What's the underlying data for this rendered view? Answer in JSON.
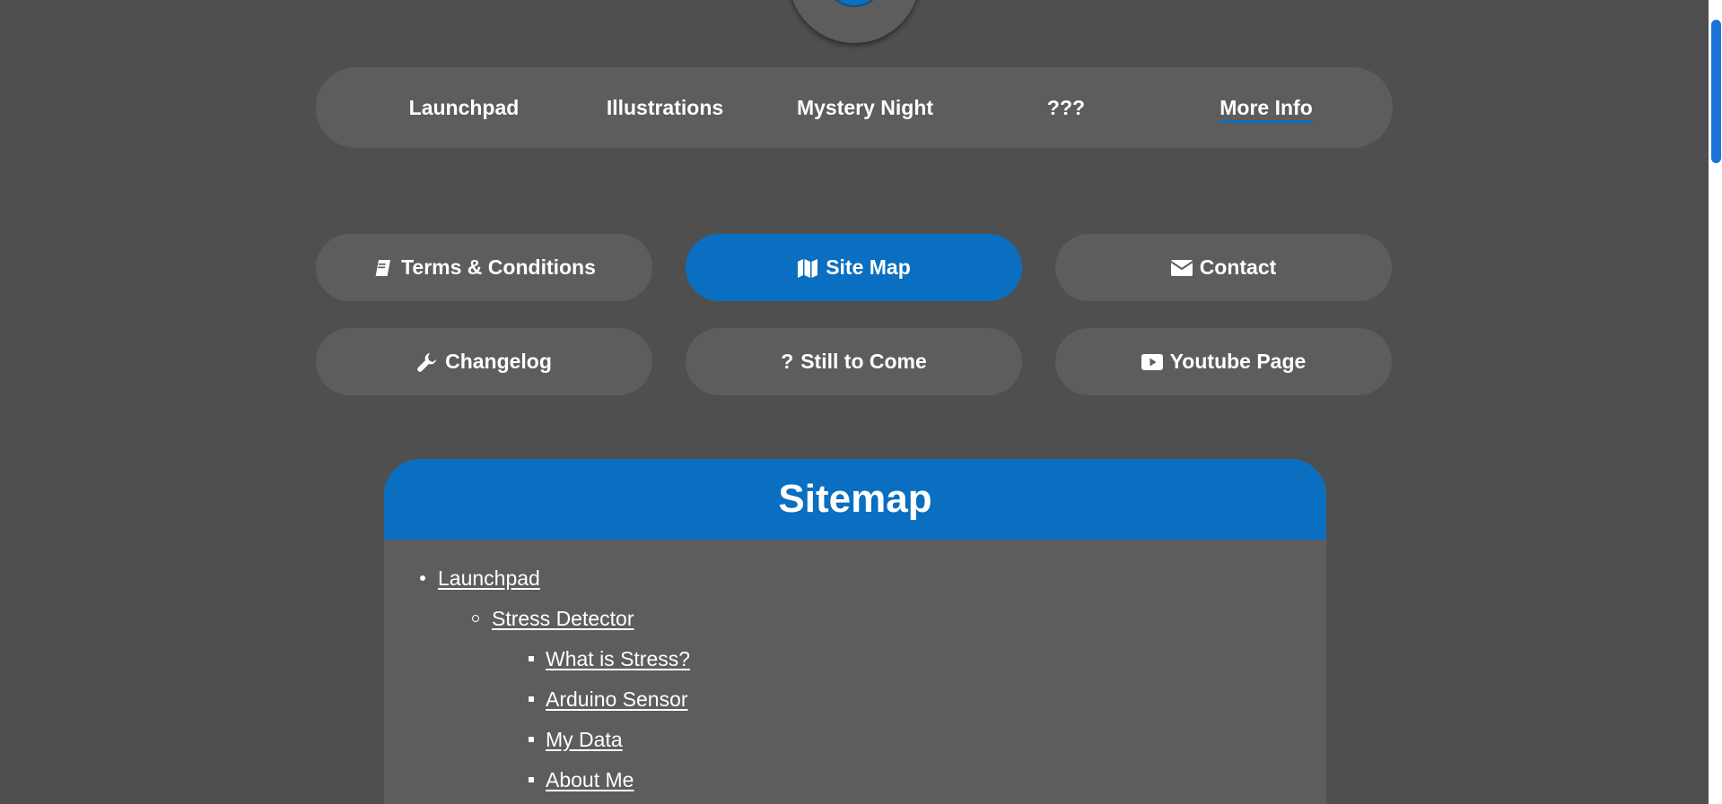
{
  "colors": {
    "background": "#4f4f4f",
    "surface": "#5d5d5d",
    "accent": "#0a6fc0",
    "text": "#ffffff",
    "scroll_thumb": "#1a73d9"
  },
  "nav": {
    "items": [
      {
        "label": "Launchpad",
        "active": false
      },
      {
        "label": "Illustrations",
        "active": false
      },
      {
        "label": "Mystery Night",
        "active": false
      },
      {
        "label": "???",
        "active": false
      },
      {
        "label": "More Info",
        "active": true
      }
    ]
  },
  "subnav": {
    "buttons": [
      {
        "label": "Terms & Conditions",
        "icon": "book-icon",
        "active": false
      },
      {
        "label": "Site Map",
        "icon": "map-icon",
        "active": true
      },
      {
        "label": "Contact",
        "icon": "envelope-icon",
        "active": false
      },
      {
        "label": "Changelog",
        "icon": "wrench-icon",
        "active": false
      },
      {
        "label": "Still to Come",
        "icon": "question-icon",
        "active": false
      },
      {
        "label": "Youtube Page",
        "icon": "youtube-icon",
        "active": false
      }
    ]
  },
  "sitemap": {
    "title": "Sitemap",
    "items": [
      {
        "label": "Launchpad",
        "level": 1
      },
      {
        "label": "Stress Detector",
        "level": 2
      },
      {
        "label": "What is Stress?",
        "level": 3
      },
      {
        "label": "Arduino Sensor",
        "level": 3
      },
      {
        "label": "My Data",
        "level": 3
      },
      {
        "label": "About Me",
        "level": 3
      }
    ]
  }
}
